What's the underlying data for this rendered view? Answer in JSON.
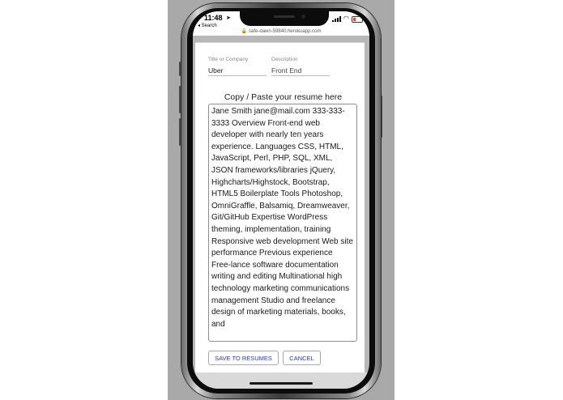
{
  "status_bar": {
    "time": "11:48",
    "back_label": "◂ Search",
    "location_icon": "location-arrow-icon",
    "battery_color": "#e0443a"
  },
  "browser": {
    "url": "safe-dawn-59840.herokuapp.com",
    "lock_icon": "lock-icon"
  },
  "form": {
    "title_label": "Title or Company",
    "title_value": "Uber",
    "description_placeholder": "Description",
    "description_value": "Front End",
    "resume_heading": "Copy / Paste your resume here",
    "resume_text": "Jane Smith jane@mail.com 333-333-3333 Overview Front-end web developer with nearly ten years experience. Languages CSS, HTML, JavaScript, Perl, PHP, SQL, XML, JSON frameworks/libraries jQuery, Highcharts/Highstock, Bootstrap, HTML5 Boilerplate Tools Photoshop, OmniGraffle, Balsamiq, Dreamweaver, Git/GitHub Expertise WordPress theming, implementation, training Responsive web development Web site performance Previous experience Free-lance software documentation writing and editing Multinational high technology marketing communications management Studio and freelance design of marketing materials, books, and",
    "save_label": "SAVE TO RESUMES",
    "cancel_label": "CANCEL",
    "accent_color": "#2b3f8f"
  }
}
